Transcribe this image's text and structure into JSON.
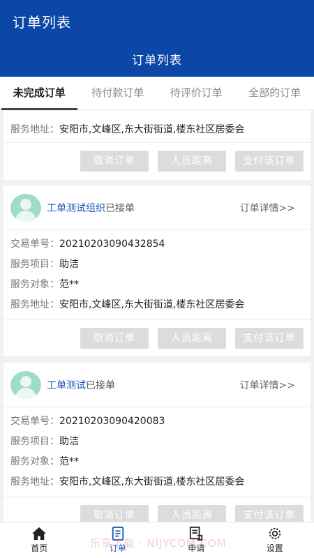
{
  "header": {
    "app_title": "订单列表",
    "page_title": "订单列表"
  },
  "tabs": [
    {
      "label": "未完成订单",
      "active": true
    },
    {
      "label": "待付款订单",
      "active": false
    },
    {
      "label": "待评价订单",
      "active": false
    },
    {
      "label": "全部的订单",
      "active": false
    }
  ],
  "labels": {
    "trade_no": "交易单号：",
    "service_item": "服务项目：",
    "service_target": "服务对象：",
    "service_address": "服务地址：",
    "detail_link": "订单详情>>"
  },
  "actions": {
    "cancel": "取消订单",
    "distance": "人员距离",
    "pay": "支付该订单"
  },
  "partial_card": {
    "address": "安阳市,文峰区,东大街街道,楼东社区居委会"
  },
  "orders": [
    {
      "org": "工单测试组织",
      "status": "已接单",
      "trade_no": "20210203090432854",
      "service_item": "助洁",
      "service_target": "范**",
      "address": "安阳市,文峰区,东大街街道,楼东社区居委会"
    },
    {
      "org": "工单测试",
      "status": "已接单",
      "trade_no": "20210203090420083",
      "service_item": "助洁",
      "service_target": "范**",
      "address": "安阳市,文峰区,东大街街道,楼东社区居委会"
    }
  ],
  "bottom_nav": [
    {
      "label": "首页",
      "icon": "home-icon"
    },
    {
      "label": "订单",
      "icon": "order-icon",
      "active": true
    },
    {
      "label": "申请",
      "icon": "apply-icon"
    },
    {
      "label": "设置",
      "icon": "settings-icon"
    }
  ],
  "watermark": "乐享下载 · NIJYCOM.COM",
  "colors": {
    "primary": "#0b47a6",
    "link": "#1a57b8",
    "button_bg": "#dcdcdc",
    "avatar": "#9fdcc4"
  }
}
